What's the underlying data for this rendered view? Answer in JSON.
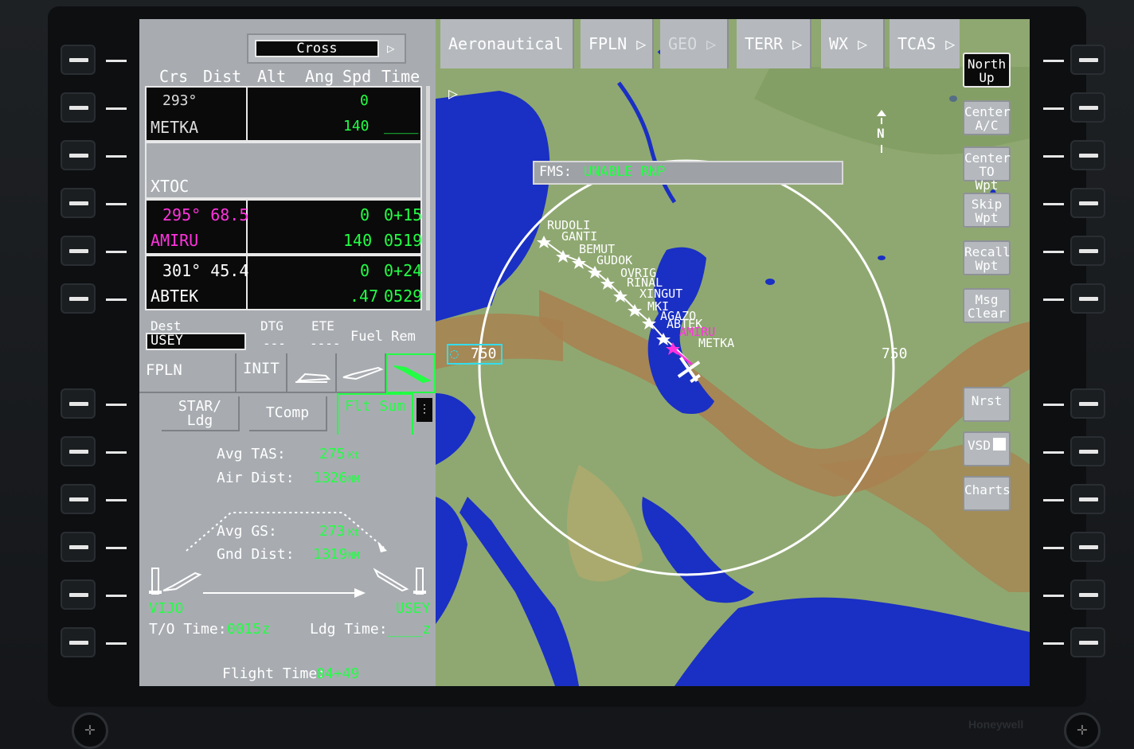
{
  "top_menu": {
    "cross": "Cross",
    "tabs": [
      "Aeronautical",
      "FPLN",
      "GEO",
      "TERR",
      "WX",
      "TCAS"
    ]
  },
  "fpln_table": {
    "headers": [
      "Crs",
      "Dist",
      "Alt",
      "Ang",
      "Spd",
      "Time"
    ],
    "rows": [
      {
        "crs_dist": "293°",
        "name": "METKA",
        "alt": "0",
        "spd": "140",
        "time": "____"
      },
      {
        "crs_dist": "",
        "name": "XTOC",
        "alt": "",
        "spd": "",
        "time": ""
      },
      {
        "crs_dist": "295° 68.5",
        "name": "AMIRU",
        "alt": "0",
        "time_top": "0+15",
        "spd": "140",
        "time": "0519"
      },
      {
        "crs_dist": "301° 45.4",
        "name": "ABTEK",
        "alt": "0",
        "time_top": "0+24",
        "spd": ".47",
        "time": "0529"
      }
    ]
  },
  "dest": {
    "label": "Dest",
    "value": "USEY",
    "dtg_label": "DTG",
    "dtg_value": "---",
    "ete_label": "ETE",
    "ete_value": "----",
    "fuel_label": "Fuel Rem"
  },
  "page_tabs": {
    "fpln": "FPLN",
    "init": "INIT",
    "star_ldg": "STAR/ Ldg",
    "tcomp": "TComp",
    "flt_sum": "Flt Sum"
  },
  "flight_summary": {
    "avg_tas_label": "Avg TAS:",
    "avg_tas_value": "275",
    "avg_tas_unit": "Kt",
    "air_dist_label": "Air Dist:",
    "air_dist_value": "1326",
    "air_dist_unit": "NM",
    "avg_gs_label": "Avg GS:",
    "avg_gs_value": "273",
    "avg_gs_unit": "Kt",
    "gnd_dist_label": "Gnd Dist:",
    "gnd_dist_value": "1319",
    "gnd_dist_unit": "NM",
    "origin": "VIJO",
    "destination": "USEY",
    "to_time_label": "T/O Time:",
    "to_time_value": "0015z",
    "ldg_time_label": "Ldg Time:",
    "ldg_time_value": "____z",
    "flight_time_label": "Flight Time:",
    "flight_time_value": "04+49"
  },
  "map": {
    "fms_label": "FMS:",
    "fms_message": "UNABLE RNP",
    "range_left": "750",
    "range_right": "750",
    "north": "N",
    "waypoints": [
      "RUDOLI",
      "GANTI",
      "BEMUT",
      "GUDOK",
      "OVRIG",
      "RINAL",
      "XINGUT",
      "MKI",
      "AGAZO",
      "ABTEK",
      "AMIRU",
      "METKA"
    ]
  },
  "side_buttons": {
    "north_up": "North Up",
    "center_ac": "Center A/C",
    "center_to_wpt": "Center TO Wpt",
    "skip_wpt": "Skip Wpt",
    "recall_wpt": "Recall Wpt",
    "msg_clear": "Msg Clear",
    "nrst": "Nrst",
    "vsd": "VSD",
    "charts": "Charts"
  },
  "brand": "Honeywell",
  "colors": {
    "green": "#22ff44",
    "magenta": "#ff33dd",
    "cyan": "#33ddee",
    "water": "#1a2fc4",
    "terrain_low": "#8fa871",
    "terrain_high": "#a87f4f"
  }
}
